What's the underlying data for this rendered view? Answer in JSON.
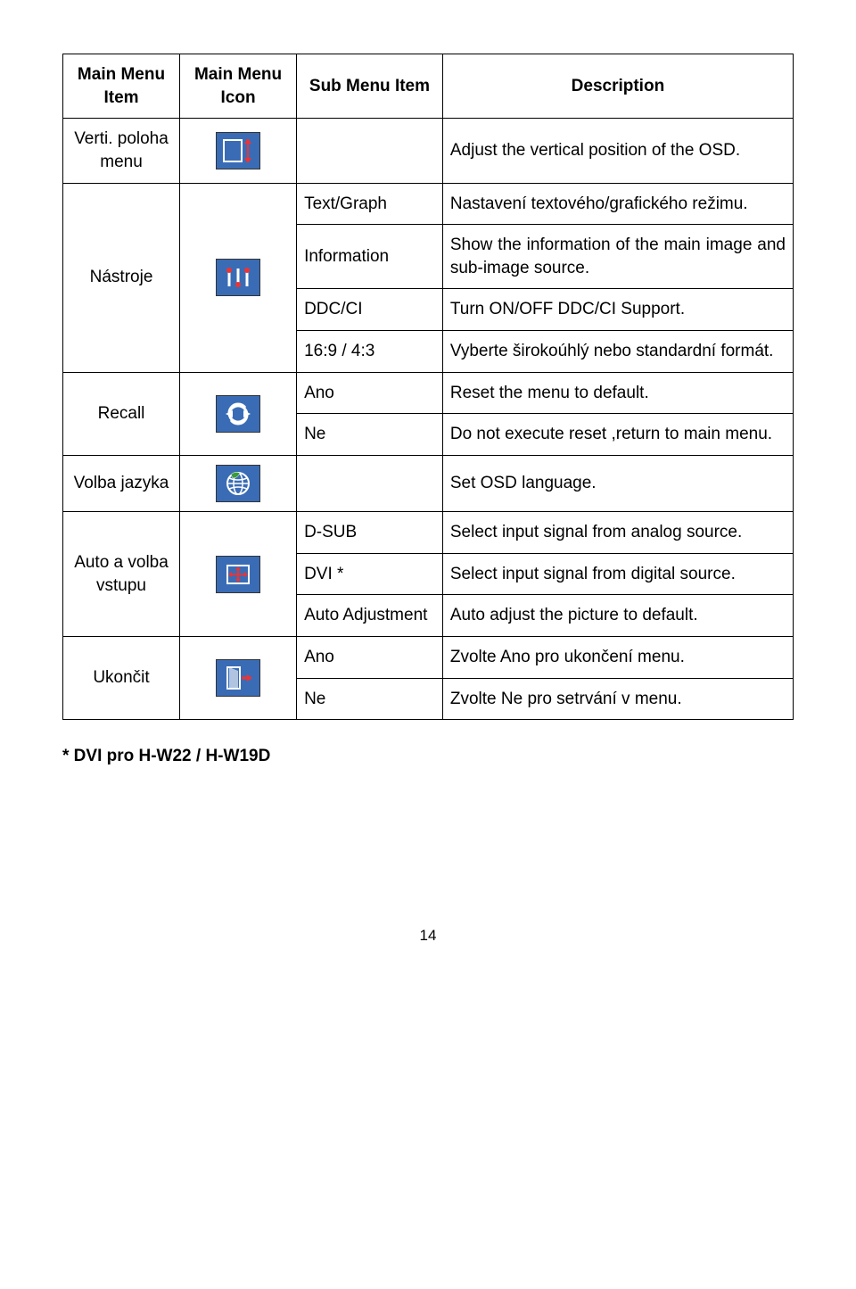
{
  "header": {
    "col1": "Main Menu Item",
    "col2": "Main Menu Icon",
    "col3": "Sub Menu Item",
    "col4": "Description"
  },
  "rows": {
    "verti_item": "Verti. poloha menu",
    "verti_desc": "Adjust the vertical position of the OSD.",
    "nastroje_item": "Nástroje",
    "textgraph_sub": "Text/Graph",
    "textgraph_desc": "Nastavení textového/grafického režimu.",
    "information_sub": "Information",
    "information_desc": "Show the information of the main image and sub-image source.",
    "ddcci_sub": "DDC/CI",
    "ddcci_desc": "Turn ON/OFF DDC/CI Support.",
    "aspect_sub": "16:9 / 4:3",
    "aspect_desc": "Vyberte širokoúhlý nebo standardní formát.",
    "recall_item": "Recall",
    "recall_ano_sub": "Ano",
    "recall_ano_desc": "Reset the menu to default.",
    "recall_ne_sub": "Ne",
    "recall_ne_desc": "Do not execute reset ,return to main menu.",
    "volba_item": "Volba jazyka",
    "volba_desc": "Set OSD language.",
    "auto_item": "Auto a volba vstupu",
    "dsub_sub": "D-SUB",
    "dsub_desc": "Select input signal from analog source.",
    "dvi_sub": "DVI *",
    "dvi_desc": "Select input signal from digital source.",
    "autoadj_sub": "Auto Adjustment",
    "autoadj_desc": "Auto adjust the picture to default.",
    "ukoncit_item": "Ukončit",
    "ukoncit_ano_sub": "Ano",
    "ukoncit_ano_desc": "Zvolte Ano pro ukončení menu.",
    "ukoncit_ne_sub": "Ne",
    "ukoncit_ne_desc": "Zvolte Ne pro setrvání v menu."
  },
  "footnote": "* DVI pro H-W22 / H-W19D",
  "page_number": "14"
}
